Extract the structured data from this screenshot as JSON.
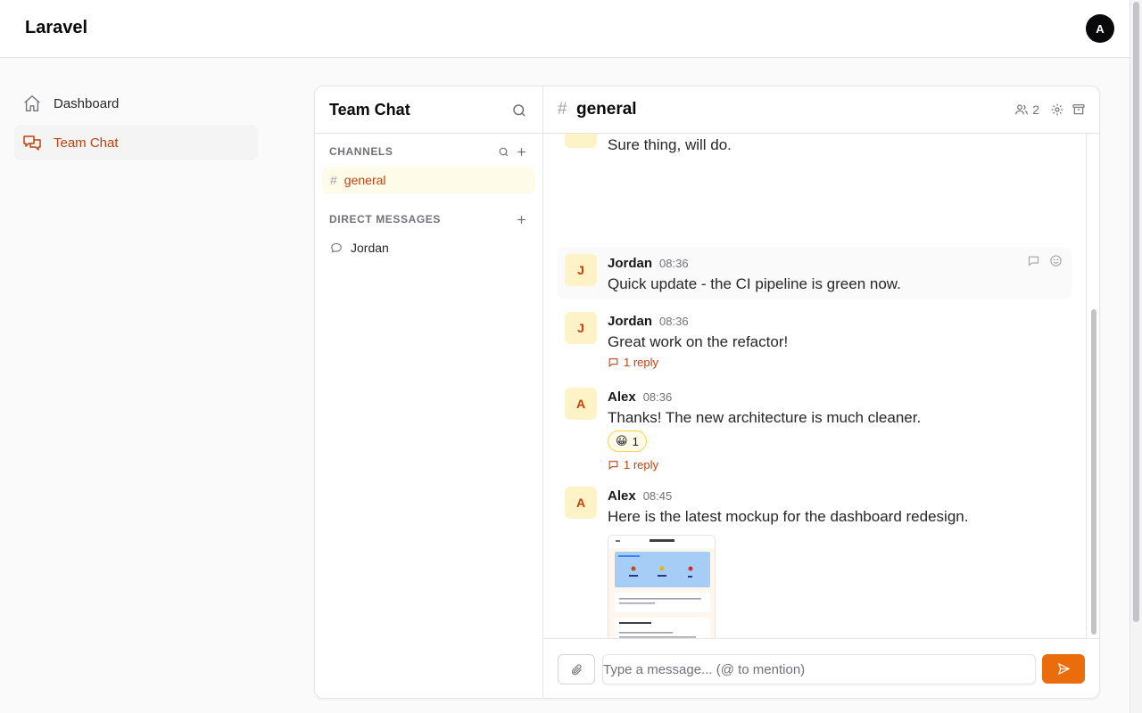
{
  "app": {
    "brand": "Laravel",
    "user_initial": "A"
  },
  "nav": {
    "items": [
      {
        "label": "Dashboard",
        "icon": "home-icon",
        "active": false
      },
      {
        "label": "Team Chat",
        "icon": "chat-bubbles-icon",
        "active": true
      }
    ]
  },
  "chat": {
    "title": "Team Chat",
    "channels_label": "CHANNELS",
    "channels": [
      {
        "name": "general",
        "active": true
      }
    ],
    "dm_label": "DIRECT MESSAGES",
    "dms": [
      {
        "name": "Jordan"
      }
    ]
  },
  "channel": {
    "hash": "#",
    "name": "general",
    "member_count": "2"
  },
  "messages": [
    {
      "initial": "",
      "author": "",
      "time": "",
      "text": "Sure thing, will do."
    },
    {
      "initial": "J",
      "author": "Jordan",
      "time": "08:36",
      "text": "Quick update - the CI pipeline is green now."
    },
    {
      "initial": "J",
      "author": "Jordan",
      "time": "08:36",
      "text": "Great work on the refactor!",
      "reply": "1 reply"
    },
    {
      "initial": "A",
      "author": "Alex",
      "time": "08:36",
      "text": "Thanks! The new architecture is much cleaner.",
      "reaction_emoji": "😀",
      "reaction_count": "1",
      "reply": "1 reply"
    },
    {
      "initial": "A",
      "author": "Alex",
      "time": "08:45",
      "text": "Here is the latest mockup for the dashboard redesign."
    }
  ],
  "composer": {
    "placeholder": "Type a message... (@ to mention)",
    "value": ""
  },
  "colors": {
    "accent": "#c2410c",
    "send": "#ea6c0a",
    "avatar_bg": "#fef3c7"
  }
}
